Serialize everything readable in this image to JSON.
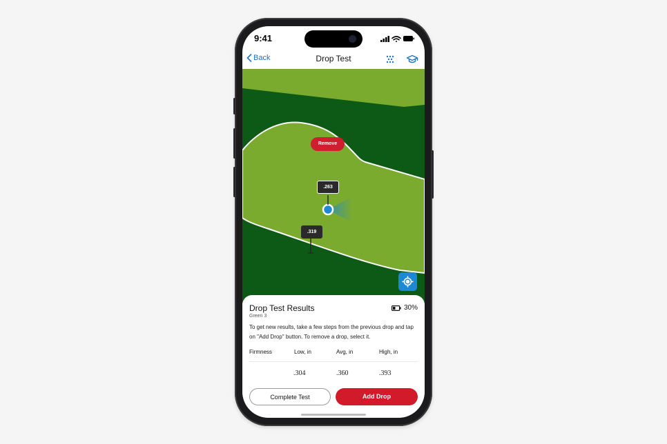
{
  "status_bar": {
    "time": "9:41"
  },
  "nav": {
    "back_label": "Back",
    "title": "Drop Test",
    "icons": [
      "grid-dots-icon",
      "graduation-cap-icon"
    ]
  },
  "map": {
    "remove_label": "Remove",
    "pins": [
      {
        "value": ".263",
        "state": "selected"
      },
      {
        "value": ".319",
        "state": "normal"
      }
    ],
    "colors": {
      "fairway": "#7aaa2e",
      "rough": "#0c5a16",
      "selected_marker": "#1e88d6"
    }
  },
  "sheet": {
    "title": "Drop Test Results",
    "battery_text": "30%",
    "subtitle": "Green 3",
    "description": "To get new results, take a few steps from the previous drop and tap on \"Add Drop\" button. To remove a drop, select it.",
    "table": {
      "headers": [
        "Firmness",
        "Low, in",
        "Avg, in",
        "High, in"
      ],
      "row": [
        "",
        ".304",
        ".360",
        ".393"
      ]
    },
    "complete_label": "Complete Test",
    "add_label": "Add Drop"
  },
  "colors": {
    "accent": "#1a73c8",
    "primary_button": "#d11a2a"
  }
}
